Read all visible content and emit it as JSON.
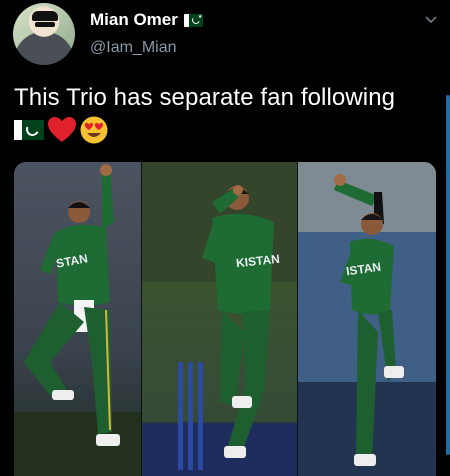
{
  "tweet": {
    "author": {
      "display_name": "Mian Omer",
      "handle": "@Iam_Mian"
    },
    "text": "This Trio has separate fan following",
    "emojis": [
      "pakistan-flag",
      "red-heart",
      "heart-eyes-face"
    ],
    "media": {
      "panels": [
        {
          "jersey_text": "STAN"
        },
        {
          "jersey_text": "KISTAN"
        },
        {
          "jersey_text": "ISTAN"
        }
      ]
    }
  },
  "colors": {
    "background": "#000000",
    "jersey_green": "#1f6b34",
    "pakistan_green": "#01411c"
  }
}
